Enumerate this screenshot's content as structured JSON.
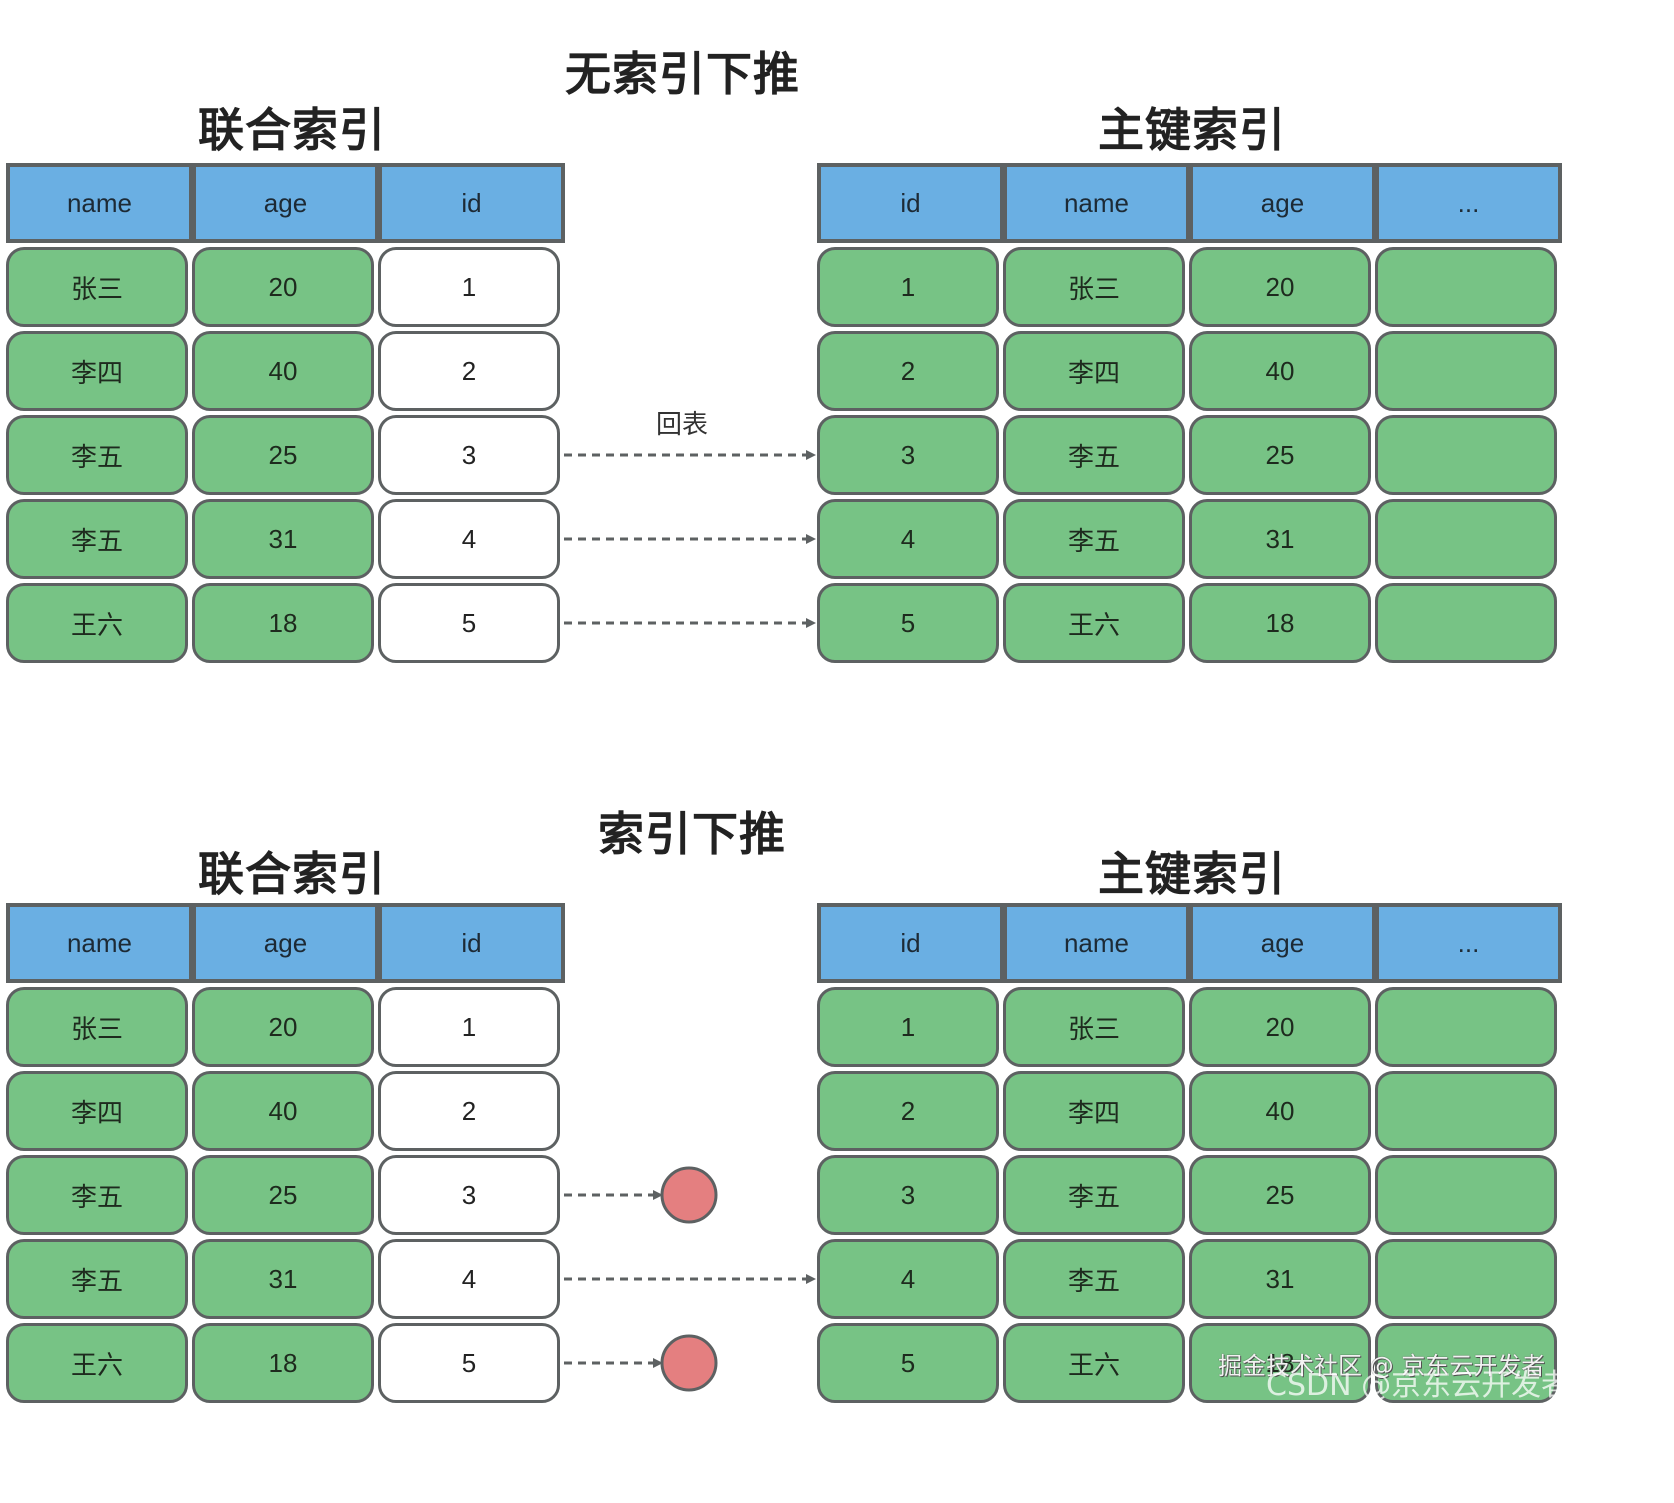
{
  "colors": {
    "header_fill": "#6aafe3",
    "row_fill": "#77c385",
    "id_cell_fill": "#ffffff",
    "border": "#5d6162",
    "filtered_circle": "#e47f80",
    "arrow": "#5d6162"
  },
  "sections": [
    {
      "title": "无索引下推",
      "composite_index": {
        "title": "联合索引",
        "columns": [
          "name",
          "age",
          "id"
        ],
        "rows": [
          [
            "张三",
            "20",
            "1"
          ],
          [
            "李四",
            "40",
            "2"
          ],
          [
            "李五",
            "25",
            "3"
          ],
          [
            "李五",
            "31",
            "4"
          ],
          [
            "王六",
            "18",
            "5"
          ]
        ]
      },
      "primary_index": {
        "title": "主键索引",
        "columns": [
          "id",
          "name",
          "age",
          "..."
        ],
        "rows": [
          [
            "1",
            "张三",
            "20",
            ""
          ],
          [
            "2",
            "李四",
            "40",
            ""
          ],
          [
            "3",
            "李五",
            "25",
            ""
          ],
          [
            "4",
            "李五",
            "31",
            ""
          ],
          [
            "5",
            "王六",
            "18",
            ""
          ]
        ]
      },
      "edge_label": "回表",
      "links": [
        {
          "from_row": 2,
          "to": "primary",
          "to_row": 2
        },
        {
          "from_row": 3,
          "to": "primary",
          "to_row": 3
        },
        {
          "from_row": 4,
          "to": "primary",
          "to_row": 4
        }
      ]
    },
    {
      "title": "索引下推",
      "composite_index": {
        "title": "联合索引",
        "columns": [
          "name",
          "age",
          "id"
        ],
        "rows": [
          [
            "张三",
            "20",
            "1"
          ],
          [
            "李四",
            "40",
            "2"
          ],
          [
            "李五",
            "25",
            "3"
          ],
          [
            "李五",
            "31",
            "4"
          ],
          [
            "王六",
            "18",
            "5"
          ]
        ]
      },
      "primary_index": {
        "title": "主键索引",
        "columns": [
          "id",
          "name",
          "age",
          "..."
        ],
        "rows": [
          [
            "1",
            "张三",
            "20",
            ""
          ],
          [
            "2",
            "李四",
            "40",
            ""
          ],
          [
            "3",
            "李五",
            "25",
            ""
          ],
          [
            "4",
            "李五",
            "31",
            ""
          ],
          [
            "5",
            "王六",
            "18",
            ""
          ]
        ]
      },
      "links": [
        {
          "from_row": 2,
          "to": "filtered"
        },
        {
          "from_row": 3,
          "to": "primary",
          "to_row": 3
        },
        {
          "from_row": 4,
          "to": "filtered"
        }
      ]
    }
  ],
  "watermarks": [
    "掘金技术社区 @ 京东云开发者",
    "CSDN @京东云开发者"
  ]
}
